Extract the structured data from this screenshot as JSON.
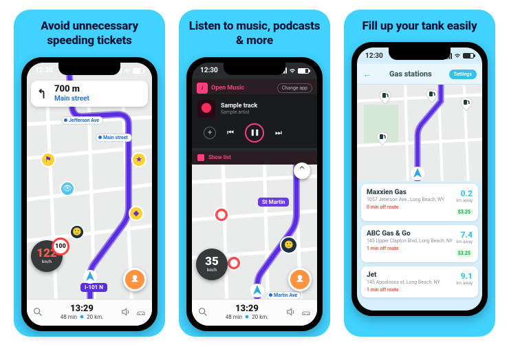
{
  "panels": {
    "speed": {
      "title": "Avoid unnecessary speeding tickets"
    },
    "music": {
      "title": "Listen to music, podcasts & more"
    },
    "gas": {
      "title": "Fill up your tank easily"
    }
  },
  "status_time": "12:30",
  "turn": {
    "distance": "700 m",
    "street": "Main street"
  },
  "speed": {
    "current": "122",
    "unit": "km/h",
    "limit": "100"
  },
  "speed2": {
    "current": "35",
    "unit": "km/h"
  },
  "road_labels": {
    "main": "Main street",
    "jefferson": "Jefferson Ave",
    "highway": "I-101 N",
    "martin": "Martin Ave",
    "stmartin": "St Martin"
  },
  "bottom": {
    "eta": "13:29",
    "duration": "48 min",
    "distance": "20 km."
  },
  "music": {
    "open_label": "Open Music",
    "change_label": "Change app",
    "track": "Sample track",
    "artist": "Sample artist",
    "showlist": "Show list"
  },
  "gas": {
    "title": "Gas stations",
    "settings": "Settings",
    "stations": [
      {
        "name": "Maxxien Gas",
        "addr": "1057 Jeterson Ave., Long Beach, WY",
        "offroute": "0 min off route",
        "dist": "0.2",
        "unit": "km away",
        "price": "$3.25"
      },
      {
        "name": "ABC Gas & Go",
        "addr": "145 Upper Clapton Blvd, Long Beach, NY",
        "offroute": "1 min off route",
        "dist": "7.4",
        "unit": "km away",
        "price": "$3.25"
      },
      {
        "name": "Jet",
        "addr": "145 Appaloosa st, Long Beach, NY",
        "offroute": "1 min off route",
        "dist": "9.1",
        "unit": "km away",
        "price": ""
      }
    ]
  }
}
